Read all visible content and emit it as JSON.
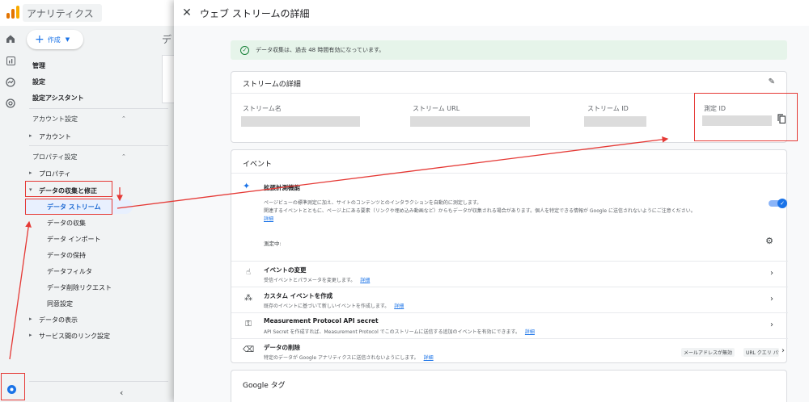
{
  "app": {
    "title": "アナリティクス"
  },
  "sidebar": {
    "create_label": "作成",
    "items_top": [
      "管理",
      "設定",
      "設定アシスタント"
    ],
    "account_section": "アカウント設定",
    "account_item": "アカウント",
    "property_section": "プロパティ設定",
    "property_item": "プロパティ",
    "data_collection": "データの収集と修正",
    "sub_items": [
      "データ ストリーム",
      "データの収集",
      "データ インポート",
      "データの保持",
      "データフィルタ",
      "データ削除リクエスト",
      "同意設定"
    ],
    "data_display": "データの表示",
    "service_links": "サービス間のリンク設定",
    "ghost_title": "デ"
  },
  "panel": {
    "title": "ウェブ ストリームの詳細",
    "banner": "データ収集は、過去 48 時間有効になっています。",
    "stream_details": {
      "title": "ストリームの詳細",
      "name_label": "ストリーム名",
      "url_label": "ストリーム URL",
      "id_label": "ストリーム ID",
      "measurement_label": "測定 ID"
    },
    "events": {
      "title": "イベント",
      "enhanced_title": "拡張計測機能",
      "enhanced_desc1": "ページビューの標準測定に加え、サイトのコンテンツとのインタラクションを自動的に測定します。",
      "enhanced_desc2": "関連するイベントとともに、ページ上にある要素（リンクや埋め込み動画など）からもデータが収集される場合があります。個人を特定できる情報が Google に送信されないようにご注意ください。",
      "detail_link": "詳細",
      "measuring": "測定中:",
      "rows": [
        {
          "title": "イベントの変更",
          "desc": "受信イベントとパラメータを変更します。",
          "link": "詳細"
        },
        {
          "title": "カスタム イベントを作成",
          "desc": "既存のイベントに基づいて新しいイベントを作成します。",
          "link": "詳細"
        },
        {
          "title": "Measurement Protocol API secret",
          "desc": "API Secret を作成すれば、Measurement Protocol でこのストリームに送信する追加のイベントを有効にできます。",
          "link": "詳細"
        },
        {
          "title": "データの削除",
          "desc": "特定のデータが Google アナリティクスに送信されないようにします。",
          "link": "詳細"
        }
      ],
      "chip1": "メールアドレスが無効",
      "chip2": "URL クエリ パラメータ キーが無効"
    },
    "google_tag": "Google タグ"
  },
  "colors": {
    "accent": "#1a73e8",
    "highlight": "#e53935",
    "banner": "#e6f4ea"
  }
}
